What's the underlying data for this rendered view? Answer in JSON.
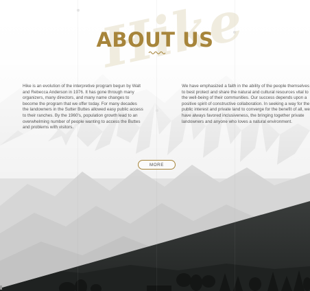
{
  "section": {
    "watermark": "Hike",
    "title": "ABOUT US"
  },
  "paragraphs": {
    "left": "Hike is an evolution of the interpretive program begun by Walt and Rebecca Anderson in 1976. It has gone through many organizers, many directors, and many name changes to become the program that we offer today. For many decades the landowners in the Sutter Buttes allowed easy public access to their ranches. By the 1960's, population growth lead to an overwhelming number of people wanting to access the Buttes and problems with visitors.",
    "right": "We have emphasized a faith in the ability of the people themselves to best protect and share the natural and cultural resources vital to the well-being of their communities. Our success depends upon a positive spirit of constructive collaboration. In seeking a way for the public interest and private land to converge for the benefit of all, we have always favored inclusiveness, the bringing together private landowners and anyone who loves a natural environment."
  },
  "more_button": {
    "label": "MORE"
  },
  "colors": {
    "accent": "#a7853b",
    "body_text": "#555555",
    "dark_band": "#2b2e2d"
  },
  "icons": {
    "divider": "squiggle-divider-icon"
  }
}
